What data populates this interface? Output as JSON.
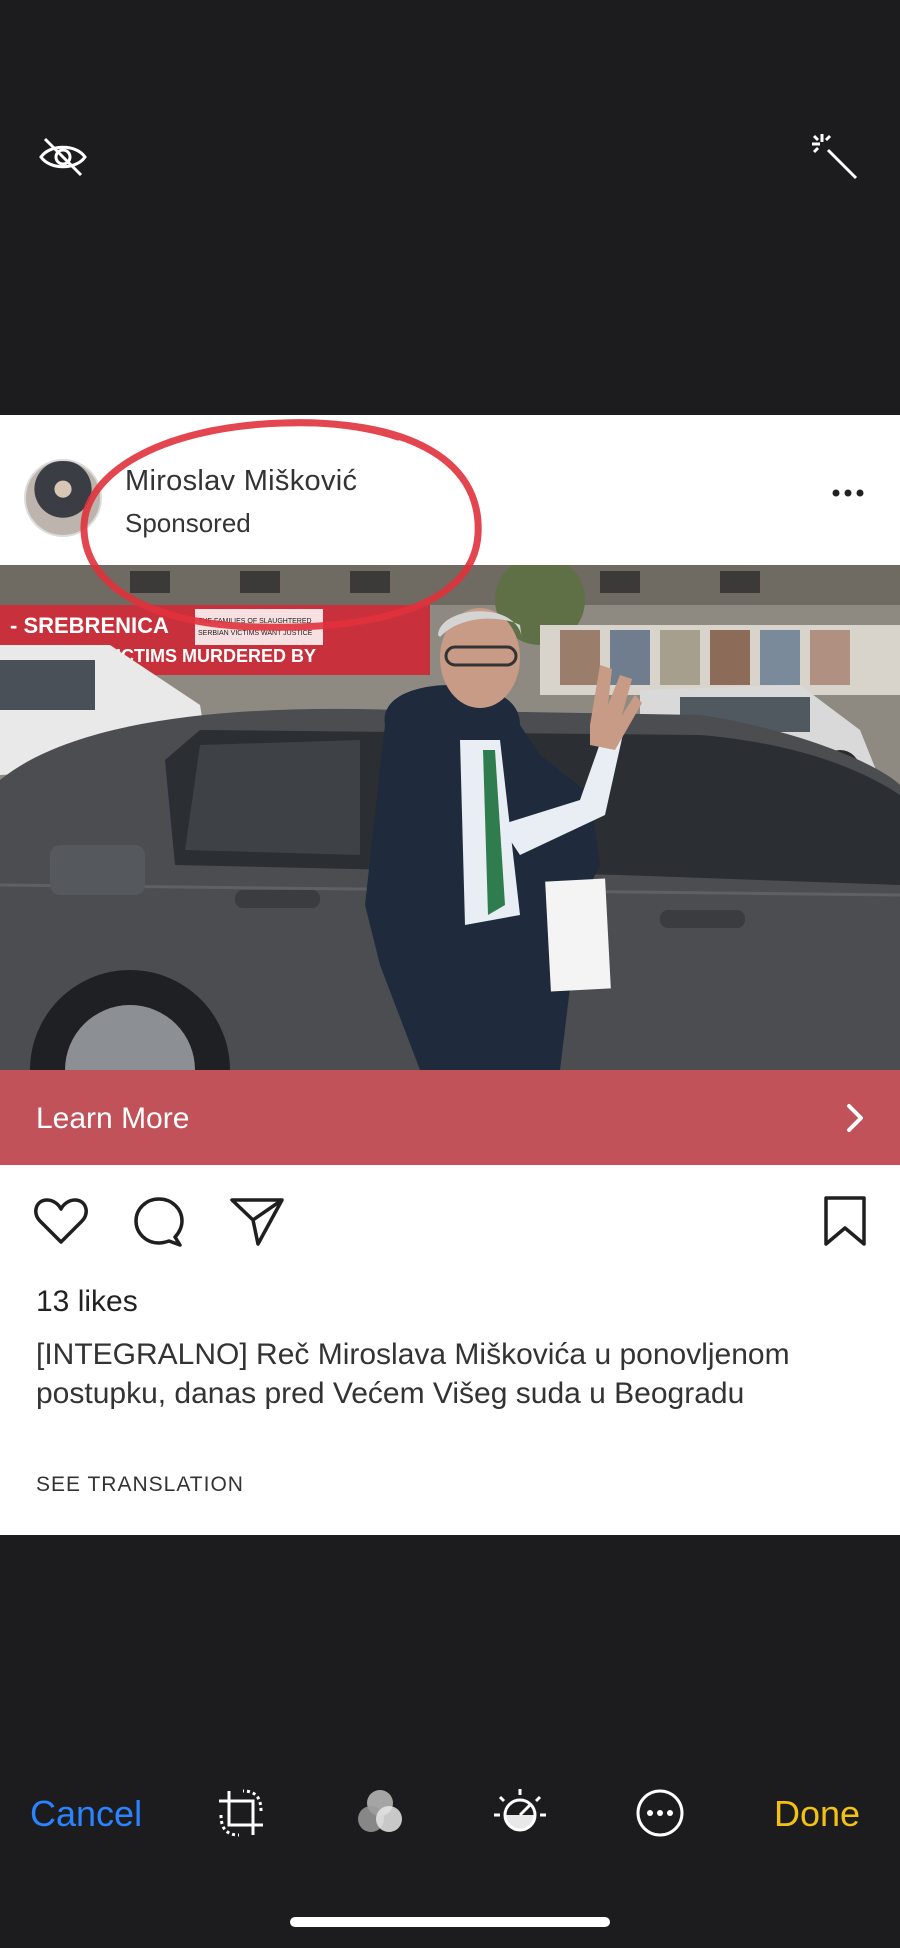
{
  "top_toolbar": {
    "left_icon": "eye-slash-icon",
    "right_icon": "magic-wand-icon"
  },
  "post": {
    "username": "Miroslav Mišković",
    "sponsored_label": "Sponsored",
    "menu_icon": "more-horizontal-icon",
    "photo_banner": {
      "line1": "- SREBRENICA",
      "line2": "SERBIAN VICTIMS MURDERED BY",
      "small1": "THE FAMILIES OF SLAUGHTERED",
      "small2": "SERBIAN VICTIMS WANT JUSTICE"
    },
    "cta_label": "Learn More",
    "likes": "13 likes",
    "caption": "[INTEGRALNO] Reč Miroslava Miškovića u ponovljenom postupku, danas pred Većem Višeg suda u Beogradu",
    "see_translation": "SEE TRANSLATION",
    "cta_color": "#c1525a",
    "annotation_color": "#e0323c"
  },
  "edit_toolbar": {
    "cancel_label": "Cancel",
    "done_label": "Done",
    "cancel_color": "#2a84ff",
    "done_color": "#f2c114",
    "tools": [
      "crop-rotate-icon",
      "filters-icon",
      "adjust-dial-icon",
      "more-options-icon"
    ]
  }
}
